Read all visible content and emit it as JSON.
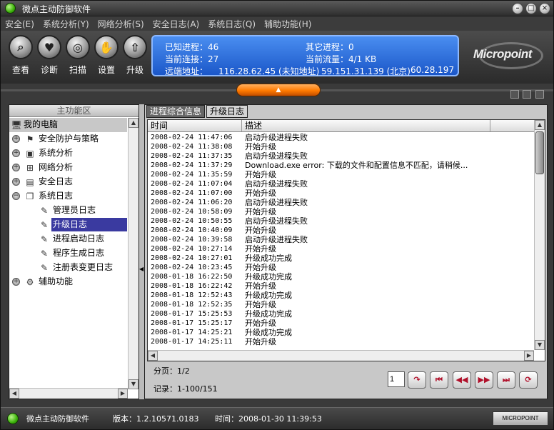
{
  "window": {
    "title": "微点主动防御软件"
  },
  "menu": [
    {
      "label": "安全(E)"
    },
    {
      "label": "系统分析(Y)"
    },
    {
      "label": "网络分析(S)"
    },
    {
      "label": "安全日志(A)"
    },
    {
      "label": "系统日志(Q)"
    },
    {
      "label": "辅助功能(H)"
    }
  ],
  "toolbar": [
    {
      "label": "查看",
      "icon": "magnifier-icon"
    },
    {
      "label": "诊断",
      "icon": "heart-icon"
    },
    {
      "label": "扫描",
      "icon": "scan-icon"
    },
    {
      "label": "设置",
      "icon": "hand-icon"
    },
    {
      "label": "升级",
      "icon": "upgrade-arrow-icon"
    }
  ],
  "status_panel": {
    "known_proc_label": "已知进程：46",
    "other_proc_label": "其它进程：0",
    "conn_label": "当前连接：27",
    "traffic_label": "当前流量：4/1 KB",
    "remote_label": "远端地址：",
    "remote_1": "116.28.62.45 (未知地址)",
    "remote_2": "59.151.31.139 (北京)",
    "remote_3": "60.28.197"
  },
  "logo": {
    "text": "Micropoint"
  },
  "left_panel": {
    "title": "主功能区",
    "tree": [
      {
        "label": "我的电脑",
        "icon": "computer-icon",
        "level": 0
      },
      {
        "label": "安全防护与策略",
        "icon": "flag-icon",
        "level": 1,
        "expander": "+"
      },
      {
        "label": "系统分析",
        "icon": "monitor-icon",
        "level": 1,
        "expander": "+"
      },
      {
        "label": "网络分析",
        "icon": "network-icon",
        "level": 1,
        "expander": "+"
      },
      {
        "label": "安全日志",
        "icon": "log-icon",
        "level": 1,
        "expander": "+"
      },
      {
        "label": "系统日志",
        "icon": "document-icon",
        "level": 1,
        "expander": "-"
      },
      {
        "label": "管理员日志",
        "icon": "admin-log-icon",
        "level": 2
      },
      {
        "label": "升级日志",
        "icon": "upgrade-log-icon",
        "level": 2,
        "selected": true
      },
      {
        "label": "进程启动日志",
        "icon": "process-log-icon",
        "level": 2
      },
      {
        "label": "程序生成日志",
        "icon": "program-log-icon",
        "level": 2
      },
      {
        "label": "注册表变更日志",
        "icon": "registry-log-icon",
        "level": 2
      },
      {
        "label": "辅助功能",
        "icon": "tools-icon",
        "level": 1,
        "expander": "+"
      }
    ]
  },
  "tabs": [
    {
      "label": "进程综合信息",
      "active": false
    },
    {
      "label": "升级日志",
      "active": true
    }
  ],
  "log_table": {
    "columns": [
      "时间",
      "描述"
    ],
    "rows": [
      [
        "2008-02-24 11:47:06",
        "启动升级进程失败"
      ],
      [
        "2008-02-24 11:38:08",
        "开始升级"
      ],
      [
        "2008-02-24 11:37:35",
        "启动升级进程失败"
      ],
      [
        "2008-02-24 11:37:29",
        "Download.exe error: 下载的文件和配置信息不匹配，请稍候..."
      ],
      [
        "2008-02-24 11:35:59",
        "开始升级"
      ],
      [
        "2008-02-24 11:07:04",
        "启动升级进程失败"
      ],
      [
        "2008-02-24 11:07:00",
        "开始升级"
      ],
      [
        "2008-02-24 11:06:20",
        "启动升级进程失败"
      ],
      [
        "2008-02-24 10:58:09",
        "开始升级"
      ],
      [
        "2008-02-24 10:50:55",
        "启动升级进程失败"
      ],
      [
        "2008-02-24 10:40:09",
        "开始升级"
      ],
      [
        "2008-02-24 10:39:58",
        "启动升级进程失败"
      ],
      [
        "2008-02-24 10:27:14",
        "开始升级"
      ],
      [
        "2008-02-24 10:27:01",
        "升级成功完成"
      ],
      [
        "2008-02-24 10:23:45",
        "开始升级"
      ],
      [
        "2008-01-18 16:22:50",
        "升级成功完成"
      ],
      [
        "2008-01-18 16:22:42",
        "开始升级"
      ],
      [
        "2008-01-18 12:52:43",
        "升级成功完成"
      ],
      [
        "2008-01-18 12:52:35",
        "开始升级"
      ],
      [
        "2008-01-17 15:25:53",
        "升级成功完成"
      ],
      [
        "2008-01-17 15:25:17",
        "开始升级"
      ],
      [
        "2008-01-17 14:25:21",
        "升级成功完成"
      ],
      [
        "2008-01-17 14:25:11",
        "开始升级"
      ]
    ]
  },
  "pager": {
    "page_text": "分页：1/2",
    "records_text": "记录：1-100/151",
    "page_value": "1"
  },
  "statusbar": {
    "app": "微点主动防御软件",
    "version": "版本：1.2.10571.0183",
    "time": "时间：2008-01-30 11:39:53",
    "brand": "MICROPOINT"
  }
}
